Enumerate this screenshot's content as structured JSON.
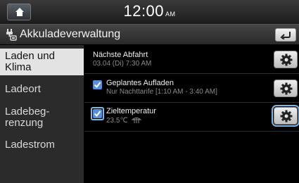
{
  "status": {
    "time": "12:00",
    "ampm": "AM"
  },
  "header": {
    "title": "Akkuladeverwaltung"
  },
  "sidebar": {
    "items": [
      {
        "label": "Laden und Klima"
      },
      {
        "label": "Ladeort"
      },
      {
        "label": "Ladebeg-renzung"
      },
      {
        "label": "Ladestrom"
      }
    ]
  },
  "main": {
    "rows": [
      {
        "title": "Nächste Abfahrt",
        "subtitle": "03.04 (Di) 7:30 AM"
      },
      {
        "title": "Geplantes Aufladen",
        "subtitle": "Nur Nachttarife [1:10 AM - 3:40 AM]",
        "checked": true
      },
      {
        "title": "Zieltemperatur",
        "subtitle": "23.5℃",
        "checked": true
      }
    ]
  },
  "icons": {
    "home": "home-icon",
    "title": "battery-plug-icon",
    "back": "back-arrow-icon",
    "settings": "gear-icon",
    "defrost": "defrost-icon",
    "check": "checkmark-icon"
  },
  "colors": {
    "accent": "#7ab8ea",
    "checkbox": "#5a90d8",
    "active_tab": "#e3e3e3"
  }
}
